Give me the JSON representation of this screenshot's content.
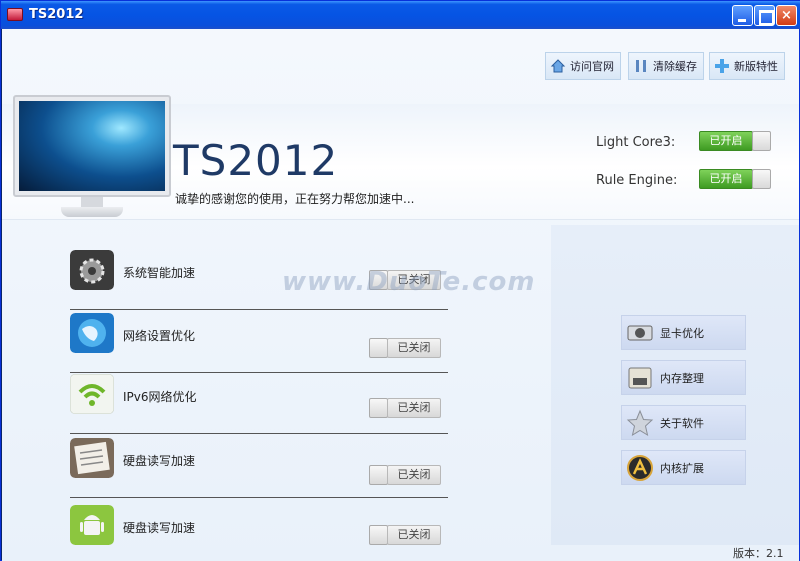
{
  "window": {
    "title": "TS2012"
  },
  "toolbar": {
    "visit_site": "访问官网",
    "clear_cache": "清除缓存",
    "new_features": "新版特性"
  },
  "banner": {
    "app_title": "TS2012",
    "subtitle": "诚挚的感谢您的使用，正在努力帮您加速中..."
  },
  "engines": [
    {
      "label": "Light Core3:",
      "state": "已开启"
    },
    {
      "label": "Rule Engine:",
      "state": "已开启"
    }
  ],
  "features": [
    {
      "label": "系统智能加速",
      "state": "已关闭",
      "icon": "gear-icon"
    },
    {
      "label": "网络设置优化",
      "state": "已关闭",
      "icon": "globe-icon"
    },
    {
      "label": "IPv6网络优化",
      "state": "已关闭",
      "icon": "wifi-icon"
    },
    {
      "label": "硬盘读写加速",
      "state": "已关闭",
      "icon": "document-icon"
    },
    {
      "label": "硬盘读写加速",
      "state": "已关闭",
      "icon": "android-icon"
    }
  ],
  "sidebar": {
    "items": [
      {
        "label": "显卡优化",
        "icon": "graphics-card-icon"
      },
      {
        "label": "内存整理",
        "icon": "memory-icon"
      },
      {
        "label": "关于软件",
        "icon": "star-icon"
      },
      {
        "label": "内核扩展",
        "icon": "kernel-icon"
      }
    ]
  },
  "footer": {
    "version": "版本：2.1"
  },
  "overlay": {
    "watermark": "www.DuoTe.com"
  },
  "colors": {
    "accent": "#0654e4",
    "on": "#3e9b22",
    "title": "#1f3a66"
  }
}
